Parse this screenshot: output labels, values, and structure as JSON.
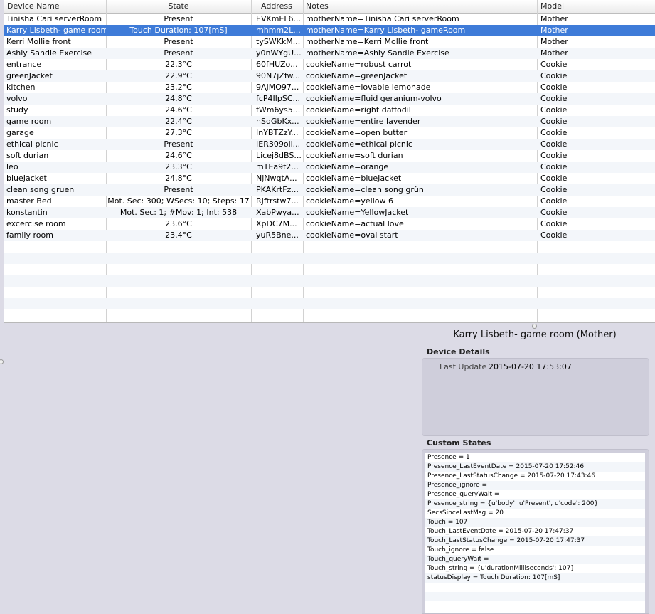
{
  "table": {
    "columns": {
      "device_name": "Device Name",
      "state": "State",
      "address": "Address",
      "notes": "Notes",
      "model": "Model"
    },
    "rows": [
      {
        "name": "Tinisha Cari serverRoom",
        "state": "Present",
        "address": "EVKmEL6...",
        "notes": "motherName=Tinisha Cari serverRoom",
        "model": "Mother"
      },
      {
        "name": "Karry Lisbeth- game room",
        "state": "Touch Duration: 107[mS]",
        "address": "mhmm2L...",
        "notes": "motherName=Karry Lisbeth- gameRoom",
        "model": "Mother",
        "selected": true
      },
      {
        "name": "Kerri Mollie front",
        "state": "Present",
        "address": "tySWKkM...",
        "notes": "motherName=Kerri Mollie front",
        "model": "Mother"
      },
      {
        "name": "Ashly Sandie Exercise",
        "state": "Present",
        "address": "y0nWYgU...",
        "notes": "motherName=Ashly Sandie Exercise",
        "model": "Mother"
      },
      {
        "name": "entrance",
        "state": "22.3°C",
        "address": "60fHUZo...",
        "notes": "cookieName=robust carrot",
        "model": "Cookie"
      },
      {
        "name": "greenJacket",
        "state": "22.9°C",
        "address": "90N7jZfw...",
        "notes": "cookieName=greenJacket",
        "model": "Cookie"
      },
      {
        "name": "kitchen",
        "state": "23.2°C",
        "address": "9AJMO97...",
        "notes": "cookieName=lovable lemonade",
        "model": "Cookie"
      },
      {
        "name": "volvo",
        "state": "24.8°C",
        "address": "fcP4IlpSC...",
        "notes": "cookieName=fluid geranium-volvo",
        "model": "Cookie"
      },
      {
        "name": "study",
        "state": "24.6°C",
        "address": "fWm6ys5...",
        "notes": "cookieName=right daffodil",
        "model": "Cookie"
      },
      {
        "name": "game room",
        "state": "22.4°C",
        "address": "hSdGbKx...",
        "notes": "cookieName=entire lavender",
        "model": "Cookie"
      },
      {
        "name": "garage",
        "state": "27.3°C",
        "address": "InYBTZzY...",
        "notes": "cookieName=open butter",
        "model": "Cookie"
      },
      {
        "name": "ethical picnic",
        "state": "Present",
        "address": "IER309oil...",
        "notes": "cookieName=ethical picnic",
        "model": "Cookie"
      },
      {
        "name": "soft durian",
        "state": "24.6°C",
        "address": "Licej8dBS...",
        "notes": "cookieName=soft durian",
        "model": "Cookie"
      },
      {
        "name": "leo",
        "state": "23.3°C",
        "address": "mTEa9t2...",
        "notes": "cookieName=orange",
        "model": "Cookie"
      },
      {
        "name": "blueJacket",
        "state": "24.8°C",
        "address": "NjNwqtA...",
        "notes": "cookieName=blueJacket",
        "model": "Cookie"
      },
      {
        "name": "clean song gruen",
        "state": "Present",
        "address": "PKAKrtFz...",
        "notes": "cookieName=clean song grün",
        "model": "Cookie"
      },
      {
        "name": "master Bed",
        "state": "Mot. Sec: 300; WSecs: 10; Steps: 17",
        "address": "RJftrstw7...",
        "notes": "cookieName=yellow 6",
        "model": "Cookie"
      },
      {
        "name": "konstantin",
        "state": "Mot. Sec: 1; #Mov: 1; Int: 538",
        "address": "XabPwya...",
        "notes": "cookieName=YellowJacket",
        "model": "Cookie"
      },
      {
        "name": "excercise room",
        "state": "23.6°C",
        "address": "XpDC7M...",
        "notes": "cookieName=actual love",
        "model": "Cookie"
      },
      {
        "name": "family room",
        "state": "23.4°C",
        "address": "yuR5Bne...",
        "notes": "cookieName=oval start",
        "model": "Cookie"
      }
    ]
  },
  "detail": {
    "title": "Karry Lisbeth- game room (Mother)",
    "device_details_label": "Device Details",
    "last_update_label": "Last Update",
    "last_update_value": "2015-07-20 17:53:07",
    "custom_states_label": "Custom States",
    "custom_states": [
      "Presence = 1",
      "Presence_LastEventDate = 2015-07-20 17:52:46",
      "Presence_LastStatusChange = 2015-07-20 17:43:46",
      "Presence_ignore =",
      "Presence_queryWait =",
      "Presence_string = {u'body': u'Present', u'code': 200}",
      "SecsSinceLastMsg = 20",
      "Touch = 107",
      "Touch_LastEventDate = 2015-07-20 17:47:37",
      "Touch_LastStatusChange = 2015-07-20 17:47:37",
      "Touch_ignore = false",
      "Touch_queryWait =",
      "Touch_string = {u'durationMilliseconds': 107}",
      "statusDisplay = Touch Duration: 107[mS]"
    ]
  },
  "colors": {
    "selection": "#3e7bd8",
    "window_bg": "#dcdbe6",
    "panel_bg": "#cfcedb",
    "alt_row": "#f3f6fa"
  }
}
